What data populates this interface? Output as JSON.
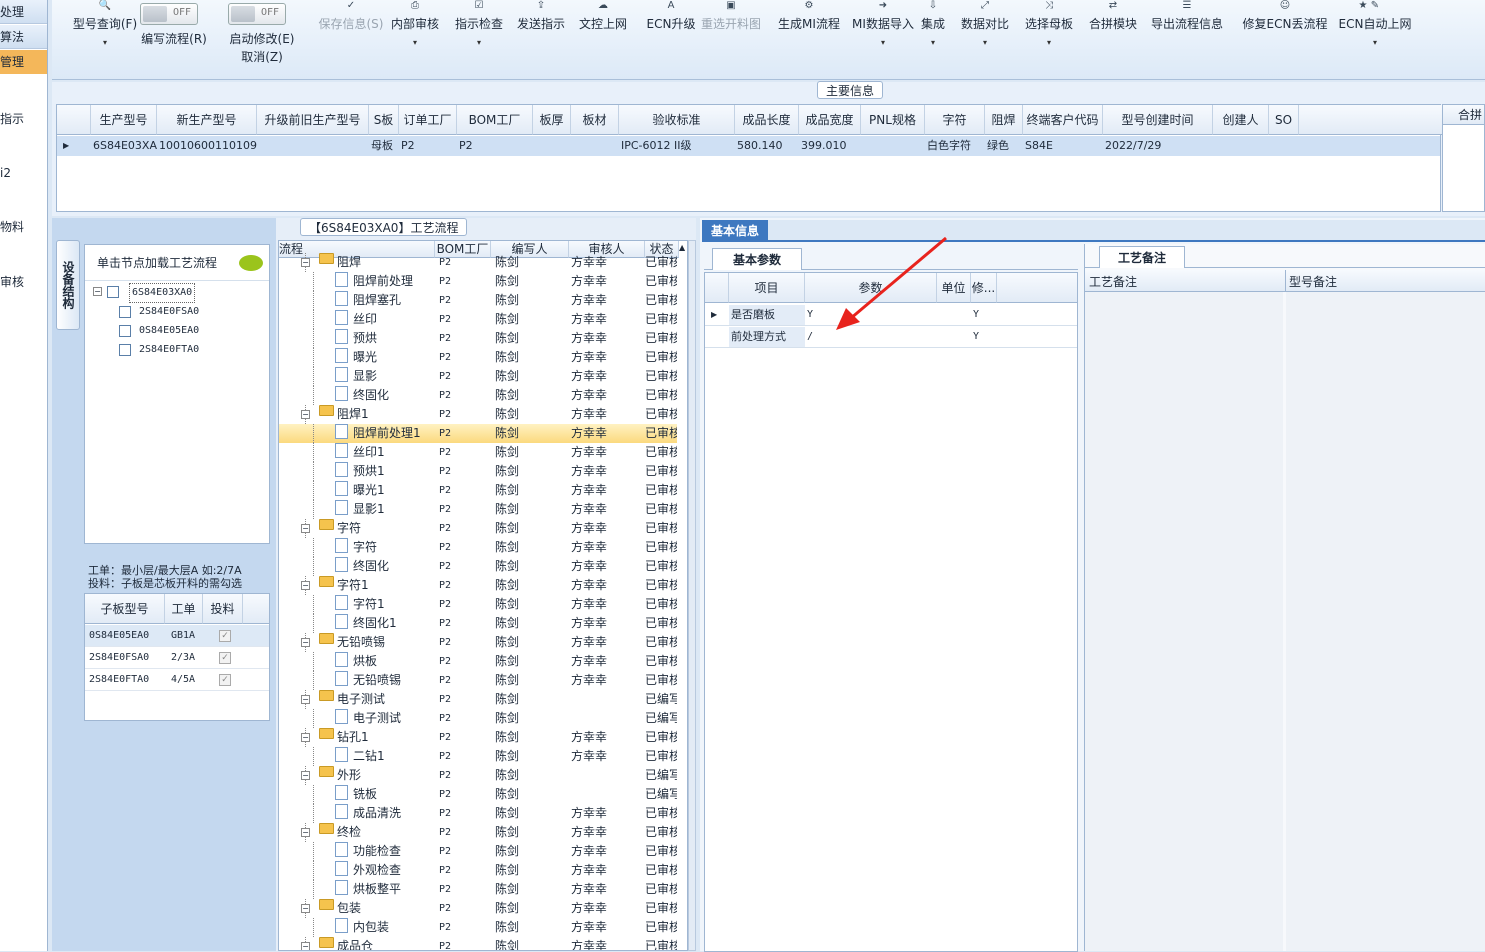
{
  "leftnav": {
    "items": [
      "处理",
      "算法",
      "管理",
      "指示",
      "i2",
      "物料",
      "审核"
    ]
  },
  "toolbar": {
    "buttons": [
      {
        "label": "型号查询(F)",
        "icon": "search-icon",
        "glyph": "🔍"
      },
      {
        "label": "编写流程(R)",
        "toggle": "OFF"
      },
      {
        "label": "启动修改(E)",
        "sub": "取消(Z)",
        "toggle": "OFF"
      },
      {
        "label": "保存信息(S)",
        "glyph": "✓"
      },
      {
        "label": "内部审核",
        "glyph": "⎙"
      },
      {
        "label": "指示检查",
        "glyph": "☑"
      },
      {
        "label": "发送指示",
        "glyph": "⇪"
      },
      {
        "label": "文控上网",
        "glyph": "☁"
      },
      {
        "label": "ECN升级",
        "glyph": "A"
      },
      {
        "label": "重选开料图",
        "glyph": "▣"
      },
      {
        "label": "生成MI流程",
        "glyph": "⚙"
      },
      {
        "label": "MI数据导入",
        "glyph": "➜"
      },
      {
        "label": "集成",
        "glyph": "⇩"
      },
      {
        "label": "数据对比",
        "glyph": "⤢"
      },
      {
        "label": "选择母板",
        "glyph": "⤨"
      },
      {
        "label": "合拼模块",
        "glyph": "⇄"
      },
      {
        "label": "导出流程信息",
        "glyph": "☰"
      },
      {
        "label": "修复ECN丢流程",
        "glyph": "☺"
      },
      {
        "label": "ECN自动上网",
        "glyph": "✎"
      },
      {
        "label": "",
        "glyph": "★"
      }
    ],
    "toggle_off": "OFF"
  },
  "main_info": {
    "tab": "主要信息",
    "right_tab": "合拼",
    "columns": [
      "生产型号",
      "新生产型号",
      "升级前旧生产型号",
      "S板",
      "订单工厂",
      "BOM工厂",
      "板厚",
      "板材",
      "验收标准",
      "成品长度",
      "成品宽度",
      "PNL规格",
      "字符",
      "阻焊",
      "终端客户代码",
      "型号创建时间",
      "创建人",
      "SO"
    ],
    "row": [
      "6S84E03XA0",
      "10010600110109",
      "",
      "母板",
      "P2",
      "P2",
      "",
      "",
      "IPC-6012 II级",
      "580.140",
      "399.010",
      "",
      "白色字符",
      "绿色",
      "S84E",
      "2022/7/29",
      "",
      ""
    ]
  },
  "structure": {
    "vtab": "设备结构",
    "hint": "单击节点加载工艺流程",
    "root": "6S84E03XA0",
    "children": [
      "2S84E0FSA0",
      "0S84E05EA0",
      "2S84E0FTA0"
    ],
    "note1": "工单：最小层/最大层A 如:2/7A",
    "note2": "投料：子板是芯板开料的需勾选",
    "sub_cols": [
      "子板型号",
      "工单",
      "投料"
    ],
    "sub_rows": [
      [
        "0S84E05EA0",
        "GB1A"
      ],
      [
        "2S84E0FSA0",
        "2/3A"
      ],
      [
        "2S84E0FTA0",
        "4/5A"
      ]
    ]
  },
  "flow": {
    "tab": "【6S84E03XA0】工艺流程",
    "cols": [
      "流程",
      "BOM工厂",
      "编写人",
      "审核人",
      "状态"
    ],
    "rows": [
      {
        "n": "阻焊",
        "f": 1,
        "b": "P2",
        "w": "陈剑",
        "r": "方幸幸",
        "s": "已审核"
      },
      {
        "n": "阻焊前处理",
        "f": 0,
        "b": "P2",
        "w": "陈剑",
        "r": "方幸幸",
        "s": "已审核"
      },
      {
        "n": "阻焊塞孔",
        "f": 0,
        "b": "P2",
        "w": "陈剑",
        "r": "方幸幸",
        "s": "已审核"
      },
      {
        "n": "丝印",
        "f": 0,
        "b": "P2",
        "w": "陈剑",
        "r": "方幸幸",
        "s": "已审核"
      },
      {
        "n": "预烘",
        "f": 0,
        "b": "P2",
        "w": "陈剑",
        "r": "方幸幸",
        "s": "已审核"
      },
      {
        "n": "曝光",
        "f": 0,
        "b": "P2",
        "w": "陈剑",
        "r": "方幸幸",
        "s": "已审核"
      },
      {
        "n": "显影",
        "f": 0,
        "b": "P2",
        "w": "陈剑",
        "r": "方幸幸",
        "s": "已审核"
      },
      {
        "n": "终固化",
        "f": 0,
        "b": "P2",
        "w": "陈剑",
        "r": "方幸幸",
        "s": "已审核"
      },
      {
        "n": "阻焊1",
        "f": 1,
        "b": "P2",
        "w": "陈剑",
        "r": "方幸幸",
        "s": "已审核"
      },
      {
        "n": "阻焊前处理1",
        "f": 0,
        "b": "P2",
        "w": "陈剑",
        "r": "方幸幸",
        "s": "已审核",
        "sel": 1
      },
      {
        "n": "丝印1",
        "f": 0,
        "b": "P2",
        "w": "陈剑",
        "r": "方幸幸",
        "s": "已审核"
      },
      {
        "n": "预烘1",
        "f": 0,
        "b": "P2",
        "w": "陈剑",
        "r": "方幸幸",
        "s": "已审核"
      },
      {
        "n": "曝光1",
        "f": 0,
        "b": "P2",
        "w": "陈剑",
        "r": "方幸幸",
        "s": "已审核"
      },
      {
        "n": "显影1",
        "f": 0,
        "b": "P2",
        "w": "陈剑",
        "r": "方幸幸",
        "s": "已审核"
      },
      {
        "n": "字符",
        "f": 1,
        "b": "P2",
        "w": "陈剑",
        "r": "方幸幸",
        "s": "已审核"
      },
      {
        "n": "字符",
        "f": 0,
        "b": "P2",
        "w": "陈剑",
        "r": "方幸幸",
        "s": "已审核"
      },
      {
        "n": "终固化",
        "f": 0,
        "b": "P2",
        "w": "陈剑",
        "r": "方幸幸",
        "s": "已审核"
      },
      {
        "n": "字符1",
        "f": 1,
        "b": "P2",
        "w": "陈剑",
        "r": "方幸幸",
        "s": "已审核"
      },
      {
        "n": "字符1",
        "f": 0,
        "b": "P2",
        "w": "陈剑",
        "r": "方幸幸",
        "s": "已审核"
      },
      {
        "n": "终固化1",
        "f": 0,
        "b": "P2",
        "w": "陈剑",
        "r": "方幸幸",
        "s": "已审核"
      },
      {
        "n": "无铅喷锡",
        "f": 1,
        "b": "P2",
        "w": "陈剑",
        "r": "方幸幸",
        "s": "已审核"
      },
      {
        "n": "烘板",
        "f": 0,
        "b": "P2",
        "w": "陈剑",
        "r": "方幸幸",
        "s": "已审核"
      },
      {
        "n": "无铅喷锡",
        "f": 0,
        "b": "P2",
        "w": "陈剑",
        "r": "方幸幸",
        "s": "已审核"
      },
      {
        "n": "电子测试",
        "f": 1,
        "b": "P2",
        "w": "陈剑",
        "r": "",
        "s": "已编写"
      },
      {
        "n": "电子测试",
        "f": 0,
        "b": "P2",
        "w": "陈剑",
        "r": "",
        "s": "已编写"
      },
      {
        "n": "钻孔1",
        "f": 1,
        "b": "P2",
        "w": "陈剑",
        "r": "方幸幸",
        "s": "已审核"
      },
      {
        "n": "二钻1",
        "f": 0,
        "b": "P2",
        "w": "陈剑",
        "r": "方幸幸",
        "s": "已审核"
      },
      {
        "n": "外形",
        "f": 1,
        "b": "P2",
        "w": "陈剑",
        "r": "",
        "s": "已编写"
      },
      {
        "n": "铣板",
        "f": 0,
        "b": "P2",
        "w": "陈剑",
        "r": "",
        "s": "已编写"
      },
      {
        "n": "成品清洗",
        "f": 0,
        "b": "P2",
        "w": "陈剑",
        "r": "方幸幸",
        "s": "已审核"
      },
      {
        "n": "终检",
        "f": 1,
        "b": "P2",
        "w": "陈剑",
        "r": "方幸幸",
        "s": "已审核"
      },
      {
        "n": "功能检查",
        "f": 0,
        "b": "P2",
        "w": "陈剑",
        "r": "方幸幸",
        "s": "已审核"
      },
      {
        "n": "外观检查",
        "f": 0,
        "b": "P2",
        "w": "陈剑",
        "r": "方幸幸",
        "s": "已审核"
      },
      {
        "n": "烘板整平",
        "f": 0,
        "b": "P2",
        "w": "陈剑",
        "r": "方幸幸",
        "s": "已审核"
      },
      {
        "n": "包装",
        "f": 1,
        "b": "P2",
        "w": "陈剑",
        "r": "方幸幸",
        "s": "已审核"
      },
      {
        "n": "内包装",
        "f": 0,
        "b": "P2",
        "w": "陈剑",
        "r": "方幸幸",
        "s": "已审核"
      },
      {
        "n": "成品仓",
        "f": 1,
        "b": "P2",
        "w": "陈剑",
        "r": "方幸幸",
        "s": "已审核"
      }
    ]
  },
  "info": {
    "tab": "基本信息",
    "subtab": "基本参数",
    "cols": [
      "项目",
      "参数",
      "单位",
      "修..."
    ],
    "rows": [
      [
        "是否磨板",
        "Y",
        "",
        "Y"
      ],
      [
        "前处理方式",
        "/",
        "",
        "Y"
      ]
    ],
    "remark_tab": "工艺备注",
    "remark_cols": [
      "工艺备注",
      "型号备注"
    ]
  },
  "colors": {
    "accent": "#f4b75a",
    "selection": "#fbd97e",
    "header_blue": "#3e78c0",
    "arrow": "#e8231d"
  }
}
